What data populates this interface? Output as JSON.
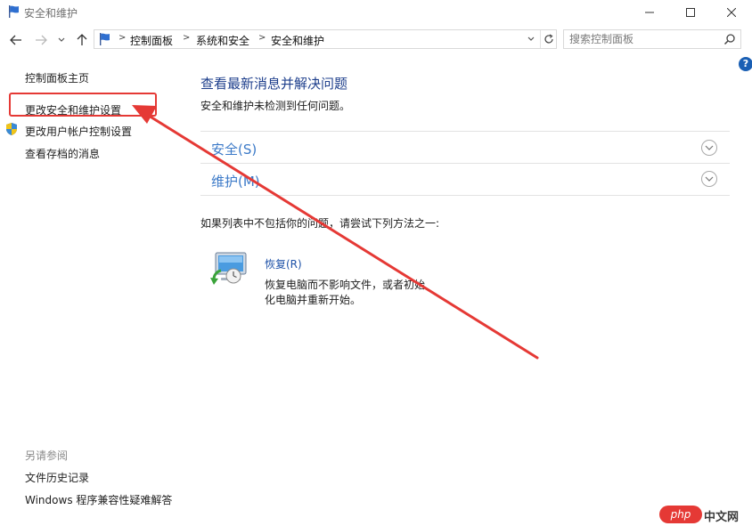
{
  "window": {
    "title": "安全和维护"
  },
  "address_bar": {
    "breadcrumbs": [
      "控制面板",
      "系统和安全",
      "安全和维护"
    ],
    "separator": ">"
  },
  "search": {
    "placeholder": "搜索控制面板"
  },
  "help": {
    "label": "?"
  },
  "left_pane": {
    "home_link": "控制面板主页",
    "links": [
      "更改安全和维护设置",
      "更改用户帐户控制设置",
      "查看存档的消息"
    ],
    "see_also_label": "另请参阅",
    "see_also_links": [
      "文件历史记录",
      "Windows 程序兼容性疑难解答"
    ]
  },
  "main": {
    "title": "查看最新消息并解决问题",
    "subtitle": "安全和维护未检测到任何问题。",
    "sections": [
      {
        "label": "安全(S)"
      },
      {
        "label": "维护(M)"
      }
    ],
    "try_text": "如果列表中不包括你的问题，请尝试下列方法之一:",
    "recovery": {
      "link": "恢复(R)",
      "description_lines": [
        "恢复电脑而不影响文件，或者初始",
        "化电脑并重新开始。"
      ]
    }
  },
  "watermark": {
    "left": "php",
    "right": "中文网"
  },
  "colors": {
    "accent": "#1e3f8c",
    "link": "#3c7ac8",
    "annotation": "#e53935"
  }
}
